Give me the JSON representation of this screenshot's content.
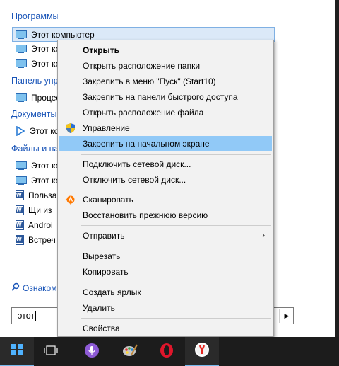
{
  "start_menu": {
    "sections": {
      "programs": "Программы",
      "control_panel": "Панель упр",
      "documents": "Документы",
      "files": "Файлы и па"
    },
    "program_rows": [
      "Этот компьютер",
      "Этот ко",
      "Этот ко"
    ],
    "control_panel_rows": [
      "Процес"
    ],
    "document_rows": [
      "Этот ко"
    ],
    "file_rows": [
      {
        "text": "Этот ко",
        "icon": "computer-icon"
      },
      {
        "text": "Этот ко",
        "icon": "computer-icon"
      },
      {
        "text": "Польза",
        "icon": "word-doc-icon"
      },
      {
        "text": "Щи из",
        "icon": "word-doc-icon"
      },
      {
        "text": "Androi",
        "icon": "word-doc-icon"
      },
      {
        "text": "Встреч",
        "icon": "word-doc-icon"
      }
    ],
    "more_link": "Ознаком",
    "search_value": "этот",
    "search_go": "▶"
  },
  "context_menu": {
    "items": [
      {
        "label": "Открыть",
        "bold": true
      },
      {
        "label": "Открыть расположение папки"
      },
      {
        "label": "Закрепить в меню \"Пуск\" (Start10)"
      },
      {
        "label": "Закрепить на панели быстрого доступа"
      },
      {
        "label": "Открыть расположение файла"
      },
      {
        "label": "Управление",
        "icon": "uac-shield-icon"
      },
      {
        "label": "Закрепить на начальном экране",
        "highlighted": true
      },
      {
        "label": "Подключить сетевой диск..."
      },
      {
        "label": "Отключить сетевой диск..."
      },
      {
        "label": "Сканировать",
        "icon": "avast-icon"
      },
      {
        "label": "Восстановить прежнюю версию"
      },
      {
        "label": "Отправить",
        "submenu": true
      },
      {
        "label": "Вырезать"
      },
      {
        "label": "Копировать"
      },
      {
        "label": "Создать ярлык"
      },
      {
        "label": "Удалить"
      },
      {
        "label": "Свойства"
      }
    ],
    "submenu_arrow": "›"
  },
  "taskbar": {
    "icons": [
      "start-icon",
      "task-view-icon",
      "cortana-mic-icon",
      "paint-icon",
      "opera-icon",
      "yandex-browser-icon"
    ]
  },
  "colors": {
    "highlight": "#91c9f7",
    "section_header": "#1a55b8",
    "selected_row": "#dbe9f8"
  }
}
